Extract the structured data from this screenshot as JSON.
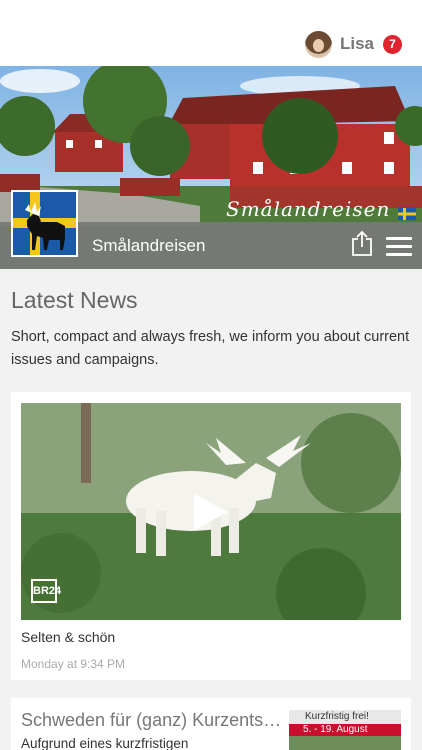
{
  "header": {
    "user_name": "Lisa",
    "notification_count": "7"
  },
  "brand": {
    "name": "Smålandreisen",
    "banner_script": "Smålandreisen"
  },
  "news": {
    "title": "Latest News",
    "subtitle": "Short, compact and always fresh, we inform you about current issues and campaigns.",
    "items": [
      {
        "title": "Selten & schön",
        "time": "Monday at 9:34 PM",
        "video_badge": "BR24"
      },
      {
        "title": "Schweden für (ganz) Kurzentschlossene",
        "subtitle": "Aufgrund eines kurzfristigen",
        "thumb_line1": "Kurzfristig frei!",
        "thumb_line2": "5. - 19. August"
      }
    ]
  },
  "colors": {
    "badge": "#e0232e",
    "band": "#787878",
    "flag_blue": "#1a5aa8",
    "flag_yellow": "#f4c51a"
  },
  "icons": {
    "share": "share-icon",
    "menu": "hamburger-menu-icon",
    "play": "play-icon"
  }
}
